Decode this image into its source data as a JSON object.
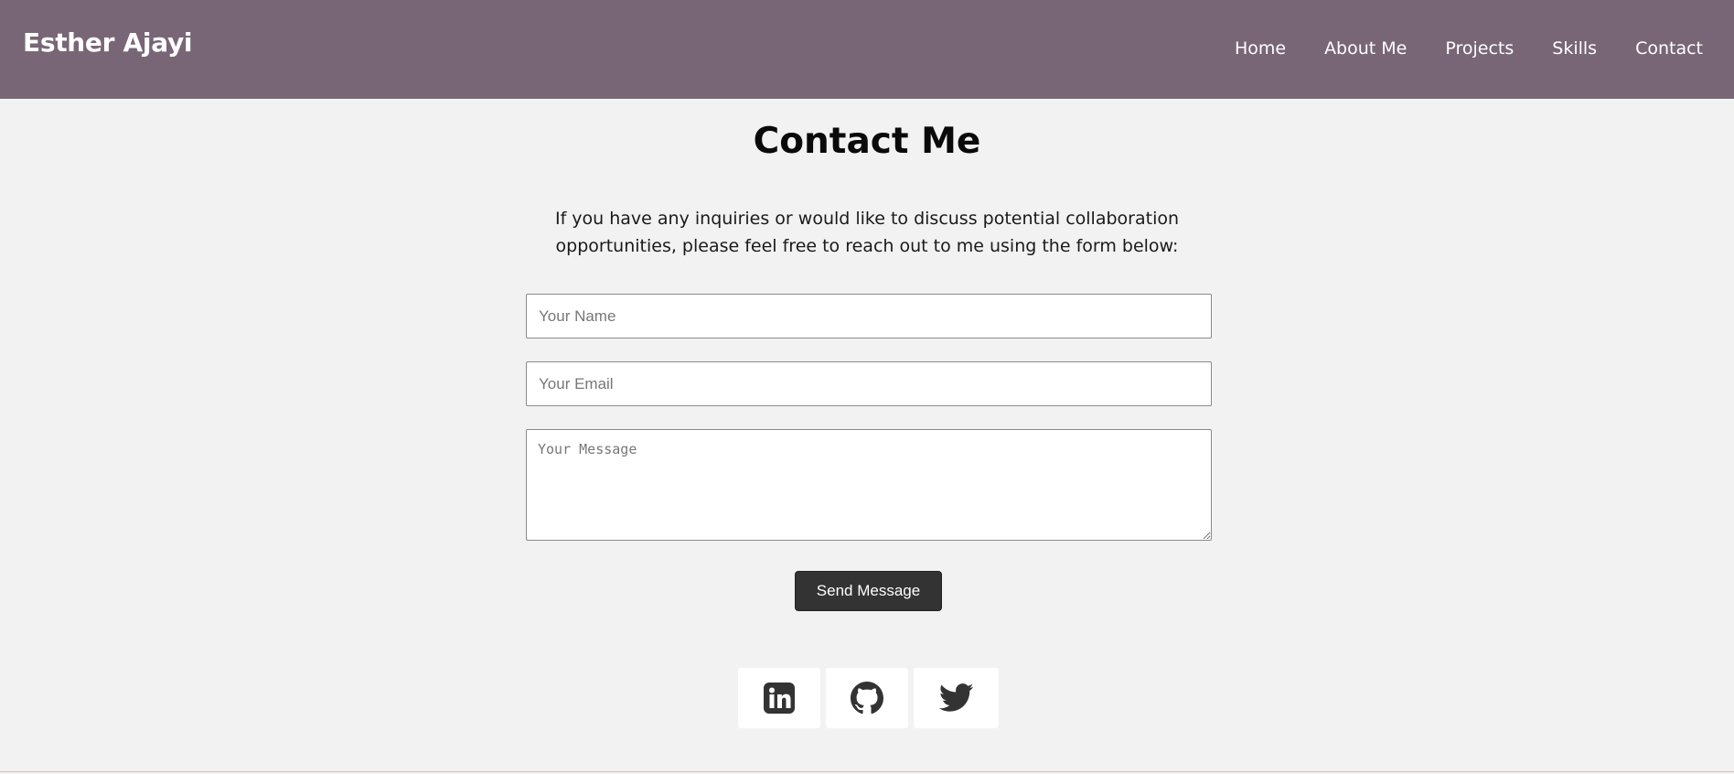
{
  "header": {
    "brand": "Esther Ajayi",
    "nav": [
      "Home",
      "About Me",
      "Projects",
      "Skills",
      "Contact"
    ]
  },
  "main": {
    "title": "Contact Me",
    "intro": "If you have any inquiries or would like to discuss potential collaboration opportunities, please feel free to reach out to me using the form below:",
    "form": {
      "name_placeholder": "Your Name",
      "email_placeholder": "Your Email",
      "message_placeholder": "Your Message",
      "send_label": "Send Message"
    }
  },
  "social": {
    "icons": [
      "linkedin-icon",
      "github-icon",
      "twitter-icon"
    ]
  },
  "colors": {
    "header_bg": "#786677",
    "page_bg": "#f2f2f2",
    "button_bg": "#333333",
    "icon": "#333333"
  }
}
